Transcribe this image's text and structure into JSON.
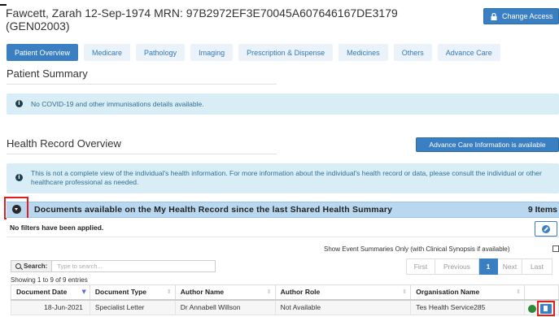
{
  "patient": {
    "header": "Fawcett, Zarah 12-Sep-1974 MRN: 97B2972EF3E70045A607646167DE3179 (GEN02003)"
  },
  "actions": {
    "change_access": "Change Access",
    "advance_care_info": "Advance Care Information is available"
  },
  "tabs": [
    {
      "label": "Patient Overview",
      "active": true
    },
    {
      "label": "Medicare",
      "active": false
    },
    {
      "label": "Pathology",
      "active": false
    },
    {
      "label": "Imaging",
      "active": false
    },
    {
      "label": "Prescription & Dispense",
      "active": false
    },
    {
      "label": "Medicines",
      "active": false
    },
    {
      "label": "Others",
      "active": false
    },
    {
      "label": "Advance Care",
      "active": false
    }
  ],
  "patient_summary": {
    "title": "Patient Summary",
    "alert": "No COVID-19 and other immunisations details available."
  },
  "health_record": {
    "title": "Health Record Overview",
    "alert": "This is not a complete view of the individual's health information. For more information about the individual's health record or data, please consult the individual or other healthcare professional as needed."
  },
  "documents": {
    "title": "Documents available on the My Health Record since the last Shared Health Summary",
    "count": "9 Items",
    "filters_text": "No filters have been applied.",
    "show_event_summaries": "Show Event Summaries Only (with Clinical Synopsis if available)",
    "search_label": "Search:",
    "search_placeholder": "Type to search...",
    "showing": "Showing 1 to 9 of 9 entries",
    "pager": {
      "first": "First",
      "previous": "Previous",
      "current": "1",
      "next": "Next",
      "last": "Last"
    },
    "columns": [
      "Document Date",
      "Document Type",
      "Author Name",
      "Author Role",
      "Organisation Name"
    ],
    "rows": [
      {
        "date": "18-Jun-2021",
        "type": "Specialist Letter",
        "author": "Dr Annabell Willson",
        "role": "Not Available",
        "org": "Tes Health Service285"
      }
    ]
  },
  "colors": {
    "primary": "#3a7fc1",
    "tab_bg": "#ebf2fa",
    "alert_bg": "#d9edf7",
    "docs_bar": "#b9d7ef",
    "highlight": "#e02020"
  }
}
